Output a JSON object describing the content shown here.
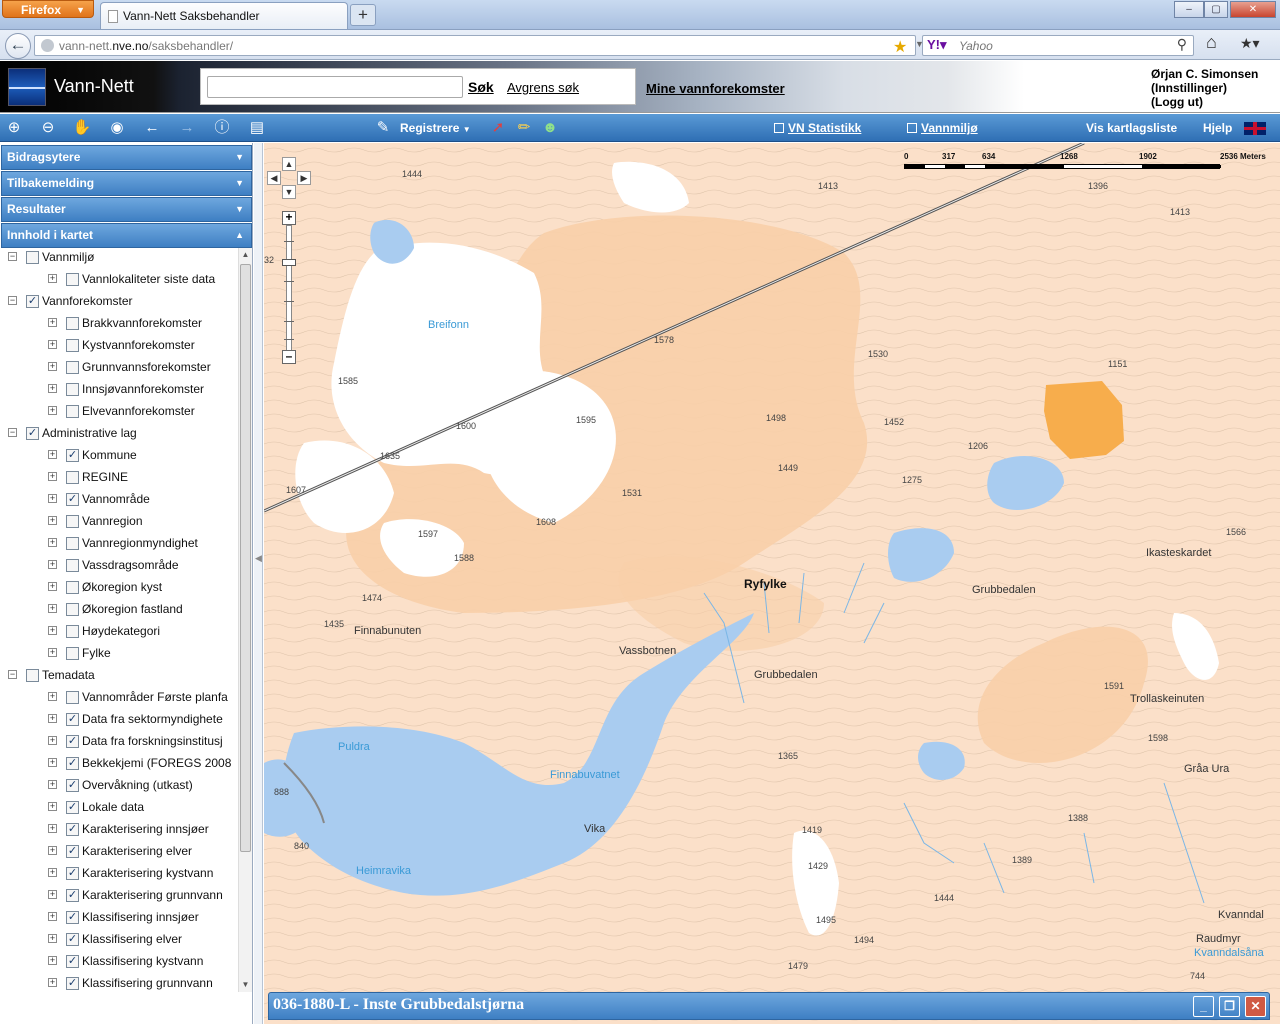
{
  "browser": {
    "menu_label": "Firefox",
    "tab_title": "Vann-Nett Saksbehandler",
    "new_tab": "+",
    "url_prefix": "vann-nett.",
    "url_host": "nve.no",
    "url_path": "/saksbehandler/",
    "search_engine": "Yahoo",
    "window_buttons": [
      "–",
      "▢",
      "✕"
    ]
  },
  "header": {
    "app_title": "Vann-Nett",
    "search_button": "Søk",
    "advanced_search": "Avgrens søk",
    "my_water_bodies": "Mine vannforekomster",
    "user_name": "Ørjan C. Simonsen",
    "user_settings": "(Innstillinger)",
    "user_logout": "(Logg ut)"
  },
  "toolbar": {
    "register_label": "Registrere",
    "vn_stats": "VN Statistikk",
    "vannmiljo": "Vannmiljø",
    "layer_list": "Vis kartlagsliste",
    "help": "Hjelp"
  },
  "sidebar": {
    "accordions": [
      {
        "label": "Bidragsytere",
        "expanded": false
      },
      {
        "label": "Tilbakemelding",
        "expanded": false
      },
      {
        "label": "Resultater",
        "expanded": false
      },
      {
        "label": "Innhold i kartet",
        "expanded": true
      }
    ],
    "tree": [
      {
        "label": "Vannmiljø",
        "level": 0,
        "checked": false,
        "sign": "−"
      },
      {
        "label": "Vannlokaliteter siste data",
        "level": 1,
        "checked": false,
        "sign": "+"
      },
      {
        "label": "Vannforekomster",
        "level": 0,
        "checked": true,
        "sign": "−"
      },
      {
        "label": "Brakkvannforekomster",
        "level": 1,
        "checked": false,
        "sign": "+"
      },
      {
        "label": "Kystvannforekomster",
        "level": 1,
        "checked": false,
        "sign": "+"
      },
      {
        "label": "Grunnvannsforekomster",
        "level": 1,
        "checked": false,
        "sign": "+"
      },
      {
        "label": "Innsjøvannforekomster",
        "level": 1,
        "checked": false,
        "sign": "+"
      },
      {
        "label": "Elvevannforekomster",
        "level": 1,
        "checked": false,
        "sign": "+"
      },
      {
        "label": "Administrative lag",
        "level": 0,
        "checked": true,
        "sign": "−"
      },
      {
        "label": "Kommune",
        "level": 1,
        "checked": true,
        "sign": "+"
      },
      {
        "label": "REGINE",
        "level": 1,
        "checked": false,
        "sign": "+"
      },
      {
        "label": "Vannområde",
        "level": 1,
        "checked": true,
        "sign": "+"
      },
      {
        "label": "Vannregion",
        "level": 1,
        "checked": false,
        "sign": "+"
      },
      {
        "label": "Vannregionmyndighet",
        "level": 1,
        "checked": false,
        "sign": "+"
      },
      {
        "label": "Vassdragsområde",
        "level": 1,
        "checked": false,
        "sign": "+"
      },
      {
        "label": "Økoregion kyst",
        "level": 1,
        "checked": false,
        "sign": "+"
      },
      {
        "label": "Økoregion fastland",
        "level": 1,
        "checked": false,
        "sign": "+"
      },
      {
        "label": "Høydekategori",
        "level": 1,
        "checked": false,
        "sign": "+"
      },
      {
        "label": "Fylke",
        "level": 1,
        "checked": false,
        "sign": "+"
      },
      {
        "label": "Temadata",
        "level": 0,
        "checked": false,
        "sign": "−"
      },
      {
        "label": "Vannområder Første planfa",
        "level": 1,
        "checked": false,
        "sign": "+"
      },
      {
        "label": "Data fra sektormyndighete",
        "level": 1,
        "checked": true,
        "sign": "+"
      },
      {
        "label": "Data fra forskningsinstitusj",
        "level": 1,
        "checked": true,
        "sign": "+"
      },
      {
        "label": "Bekkekjemi (FOREGS 2008",
        "level": 1,
        "checked": true,
        "sign": "+"
      },
      {
        "label": "Overvåkning (utkast)",
        "level": 1,
        "checked": true,
        "sign": "+"
      },
      {
        "label": "Lokale data",
        "level": 1,
        "checked": true,
        "sign": "+"
      },
      {
        "label": "Karakterisering innsjøer",
        "level": 1,
        "checked": true,
        "sign": "+"
      },
      {
        "label": "Karakterisering elver",
        "level": 1,
        "checked": true,
        "sign": "+"
      },
      {
        "label": "Karakterisering kystvann",
        "level": 1,
        "checked": true,
        "sign": "+"
      },
      {
        "label": "Karakterisering grunnvann",
        "level": 1,
        "checked": true,
        "sign": "+"
      },
      {
        "label": "Klassifisering innsjøer",
        "level": 1,
        "checked": true,
        "sign": "+"
      },
      {
        "label": "Klassifisering elver",
        "level": 1,
        "checked": true,
        "sign": "+"
      },
      {
        "label": "Klassifisering kystvann",
        "level": 1,
        "checked": true,
        "sign": "+"
      },
      {
        "label": "Klassifisering grunnvann",
        "level": 1,
        "checked": true,
        "sign": "+"
      }
    ]
  },
  "map": {
    "scale_labels": [
      "0",
      "317",
      "634",
      "1268",
      "1902",
      "2536 Meters"
    ],
    "places": [
      {
        "name": "Breifonn",
        "water": true
      },
      {
        "name": "Ryfylke",
        "bold": true
      },
      {
        "name": "Grubbedalen"
      },
      {
        "name": "Ikasteskardet"
      },
      {
        "name": "Finnabunuten"
      },
      {
        "name": "Vassbotnen"
      },
      {
        "name": "Grubbedalen"
      },
      {
        "name": "Trollaskeinuten"
      },
      {
        "name": "Puldra",
        "water": true
      },
      {
        "name": "Finnabuvatnet",
        "water": true
      },
      {
        "name": "Vika"
      },
      {
        "name": "Heimravika",
        "water": true
      },
      {
        "name": "Gråa Ura"
      },
      {
        "name": "Kvanndal"
      },
      {
        "name": "Raudmyr"
      },
      {
        "name": "Kvanndalsåna",
        "water": true
      }
    ],
    "elevations": [
      "1444",
      "1413",
      "1396",
      "1413",
      "1585",
      "1578",
      "1530",
      "1151",
      "1600",
      "1595",
      "1498",
      "1452",
      "1635",
      "1206",
      "1449",
      "1275",
      "1607",
      "1531",
      "1566",
      "1597",
      "1608",
      "1588",
      "1474",
      "1435",
      "1591",
      "1598",
      "1365",
      "1419",
      "1429",
      "1388",
      "1389",
      "1495",
      "1494",
      "1444",
      "1479",
      "888",
      "840",
      "744",
      "32"
    ]
  },
  "feature_panel": {
    "title": "036-1880-L - Inste Grubbedalstjørna",
    "buttons": [
      "_",
      "❐",
      "✕"
    ]
  }
}
